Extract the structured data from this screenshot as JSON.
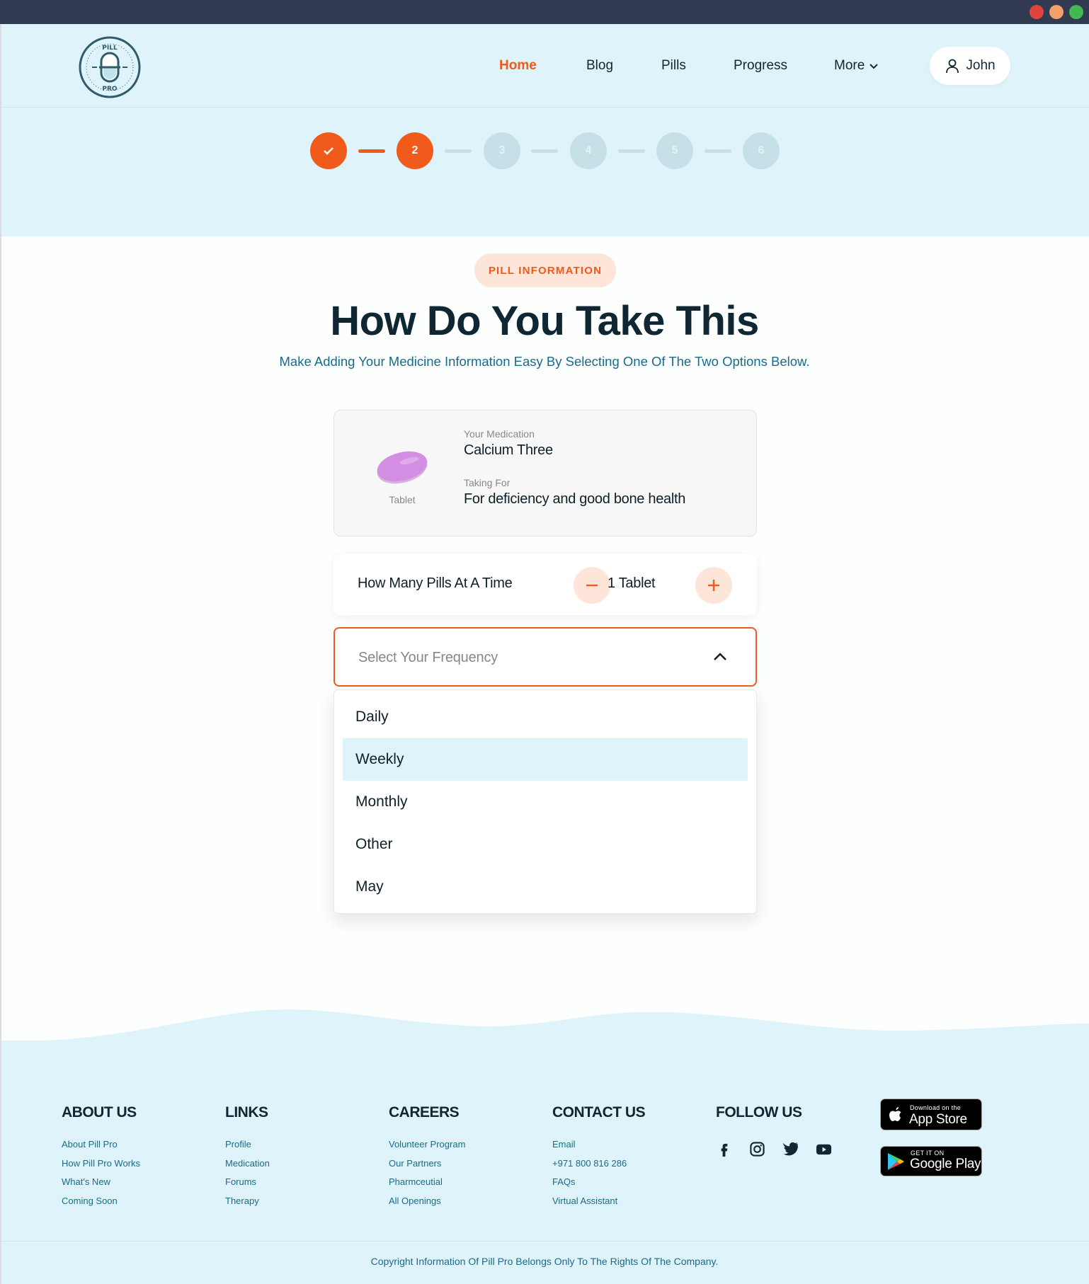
{
  "brand": {
    "logo_text_top": "PILL",
    "logo_text_bottom": "PRO"
  },
  "nav": {
    "items": [
      {
        "label": "Home",
        "active": true
      },
      {
        "label": "Blog",
        "active": false
      },
      {
        "label": "Pills",
        "active": false
      },
      {
        "label": "Progress",
        "active": false
      },
      {
        "label": "More",
        "active": false
      }
    ],
    "user_name": "John"
  },
  "stepper": {
    "steps": [
      "✓",
      "2",
      "3",
      "4",
      "5",
      "6"
    ],
    "completed": 1,
    "current": 2
  },
  "section": {
    "badge": "PILL INFORMATION",
    "title": "How Do You Take This",
    "subtitle": "Make Adding Your Medicine Information Easy By Selecting One Of The Two Options Below."
  },
  "medication": {
    "form": "Tablet",
    "name_label": "Your Medication",
    "name": "Calcium Three",
    "purpose_label": "Taking For",
    "purpose": "For deficiency and good bone health",
    "pill_color": "#d48ee3"
  },
  "quantity": {
    "label": "How Many Pills At A Time",
    "value": "1 Tablet"
  },
  "frequency": {
    "placeholder": "Select Your Frequency",
    "options": [
      "Daily",
      "Weekly",
      "Monthly",
      "Other",
      "May"
    ],
    "highlighted": "Weekly"
  },
  "footer": {
    "columns": [
      {
        "heading": "ABOUT US",
        "links": [
          "About Pill Pro",
          "How Pill Pro Works",
          "What's New",
          "Coming Soon"
        ]
      },
      {
        "heading": "LINKS",
        "links": [
          "Profile",
          "Medication",
          "Forums",
          "Therapy"
        ]
      },
      {
        "heading": "CAREERS",
        "links": [
          "Volunteer Program",
          "Our Partners",
          "Pharmceutial",
          "All Openings"
        ]
      },
      {
        "heading": "CONTACT US",
        "links": [
          "Email",
          "+971 800 816 286",
          "FAQs",
          "Virtual Assistant"
        ]
      }
    ],
    "follow_heading": "FOLLOW US",
    "social_icons": [
      "facebook-icon",
      "instagram-icon",
      "twitter-icon",
      "youtube-icon"
    ],
    "app_store": {
      "small": "Download on the",
      "big": "App Store"
    },
    "google_play": {
      "small": "GET IT ON",
      "big": "Google Play"
    },
    "copyright": "Copyright Information Of Pill Pro Belongs Only To The Rights Of The Company."
  },
  "colors": {
    "accent": "#f05a1a",
    "header_bg": "#dff3fb",
    "dark_text": "#0f2733",
    "link_text": "#186b8a"
  }
}
